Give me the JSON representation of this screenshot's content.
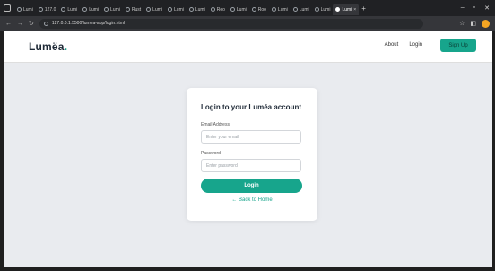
{
  "browser": {
    "tabs": [
      {
        "label": "Lumi"
      },
      {
        "label": "127.0"
      },
      {
        "label": "Lumi"
      },
      {
        "label": "Lumi"
      },
      {
        "label": "Lumi"
      },
      {
        "label": "Rust"
      },
      {
        "label": "Lumi"
      },
      {
        "label": "Lumi"
      },
      {
        "label": "Lumi"
      },
      {
        "label": "Roo"
      },
      {
        "label": "Lumi"
      },
      {
        "label": "Roo"
      },
      {
        "label": "Lumi"
      },
      {
        "label": "Lumi"
      },
      {
        "label": "Lumi"
      }
    ],
    "active_tab_label": "Lumi",
    "new_tab_label": "+",
    "url": "127.0.0.1:5500/lumea-app/login.html",
    "minimize": "–",
    "maximize": "▫",
    "close": "✕",
    "back": "←",
    "forward": "→",
    "reload": "↻"
  },
  "page": {
    "brand": "Lumëa",
    "brand_dot": ".",
    "nav": {
      "about": "About",
      "login": "Login",
      "signup": "Sign Up"
    },
    "card": {
      "title": "Login to your Luméa account",
      "email_label": "Email Address",
      "email_placeholder": "Enter your email",
      "password_label": "Password",
      "password_placeholder": "Enter password",
      "login_button": "Login",
      "back_link": "← Back to Home"
    }
  },
  "colors": {
    "accent": "#17a58c",
    "page_bg": "#e9ebef",
    "chrome_dark": "#202124"
  }
}
